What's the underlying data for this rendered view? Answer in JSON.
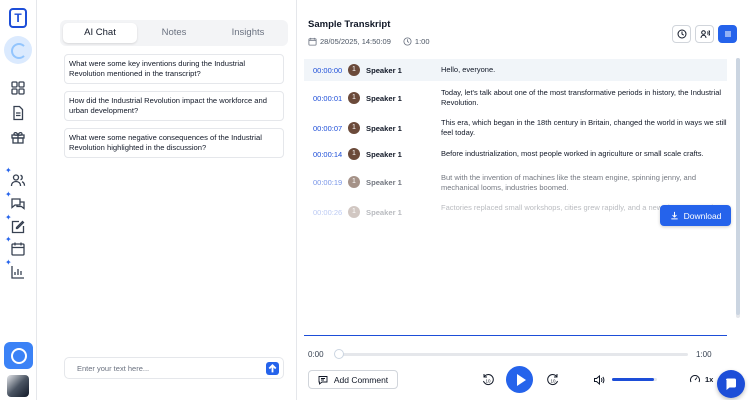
{
  "rail": {
    "logo_letter": "T"
  },
  "tabs": [
    {
      "label": "AI Chat",
      "active": true
    },
    {
      "label": "Notes",
      "active": false
    },
    {
      "label": "Insights",
      "active": false
    }
  ],
  "questions": [
    "What were some key inventions during the Industrial Revolution mentioned in the transcript?",
    "How did the Industrial Revolution impact the workforce and urban development?",
    "What were some negative consequences of the Industrial Revolution highlighted in the discussion?"
  ],
  "chat_input": {
    "placeholder": "Enter your text here...",
    "send_icon": "arrow-up-icon"
  },
  "header": {
    "title": "Sample Transkript",
    "date": "28/05/2025, 14:50:09",
    "duration": "1:00"
  },
  "transcript": [
    {
      "time": "00:00:00",
      "speaker_num": "1",
      "speaker": "Speaker 1",
      "text": "Hello, everyone."
    },
    {
      "time": "00:00:01",
      "speaker_num": "1",
      "speaker": "Speaker 1",
      "text": "Today, let's talk about one of the most transformative periods in history, the Industrial Revolution."
    },
    {
      "time": "00:00:07",
      "speaker_num": "1",
      "speaker": "Speaker 1",
      "text": "This era, which began in the 18th century in Britain, changed the world in ways we still feel today."
    },
    {
      "time": "00:00:14",
      "speaker_num": "1",
      "speaker": "Speaker 1",
      "text": "Before industrialization, most people worked in agriculture or small scale crafts."
    },
    {
      "time": "00:00:19",
      "speaker_num": "1",
      "speaker": "Speaker 1",
      "text": "But with the invention of machines like the steam engine, spinning jenny, and mechanical looms, industries boomed."
    },
    {
      "time": "00:00:26",
      "speaker_num": "1",
      "speaker": "Speaker 1",
      "text": "Factories replaced small workshops, cities grew rapidly, and a new class emerged."
    }
  ],
  "download_label": "Download",
  "player": {
    "current": "0:00",
    "total": "1:00",
    "add_comment": "Add Comment",
    "speed": "1x",
    "volume_fraction": 0.93
  },
  "colors": {
    "accent": "#2563eb",
    "speaker_badge": "#6b4a3a"
  }
}
